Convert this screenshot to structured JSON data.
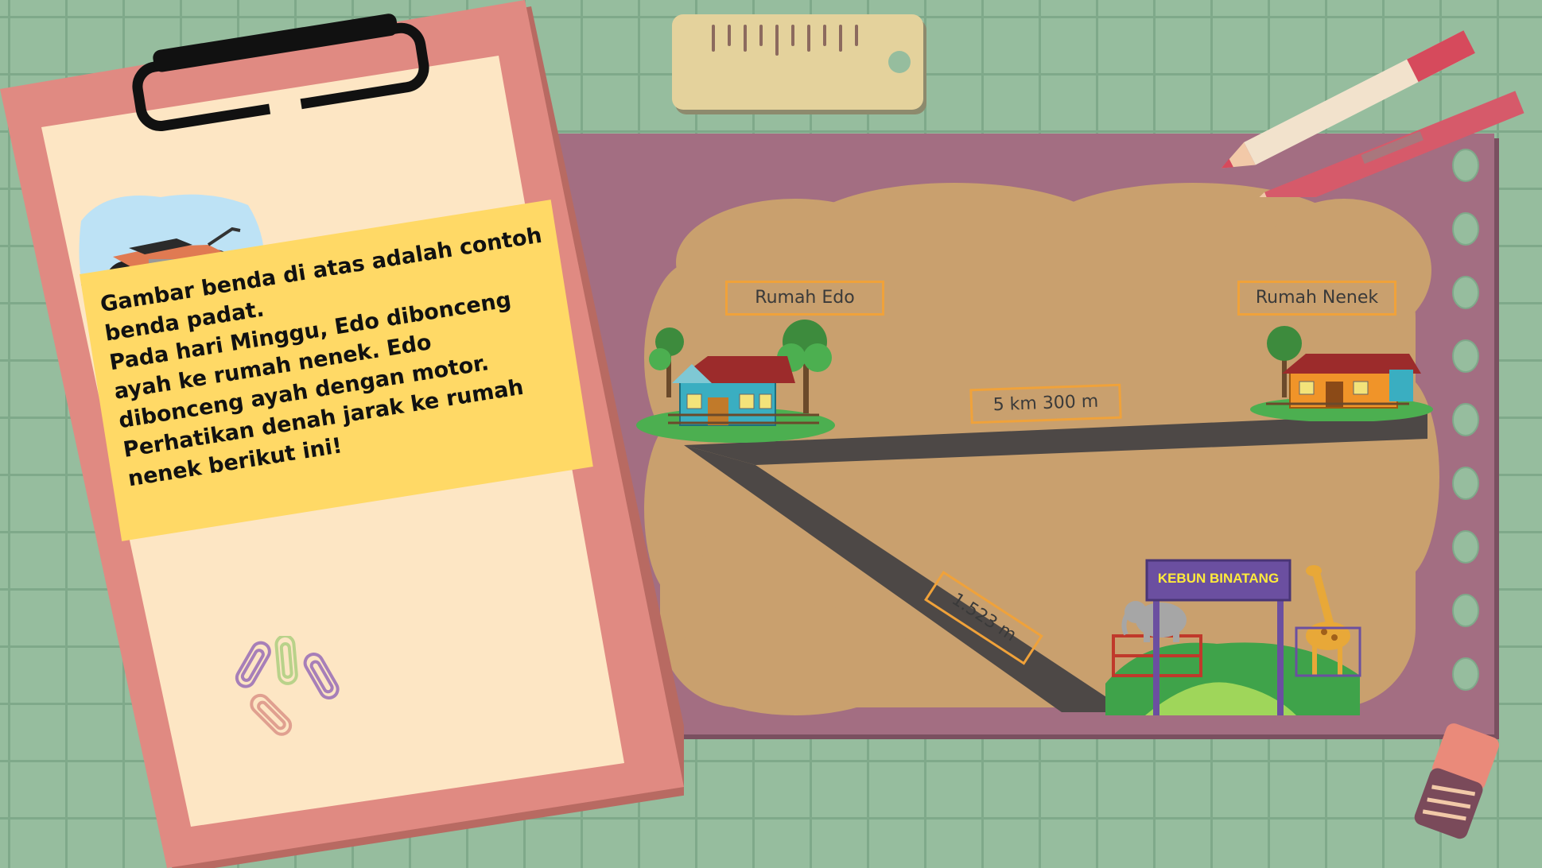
{
  "card": {
    "text_line1": "Gambar benda di atas adalah contoh benda padat.",
    "text_line2": "Pada hari Minggu, Edo dibonceng ayah ke rumah nenek. Edo dibonceng ayah dengan motor. Perhatikan denah jarak ke rumah nenek berikut ini!"
  },
  "map": {
    "label_edo": "Rumah Edo",
    "label_nenek": "Rumah Nenek",
    "distance_main": "5 km 300 m",
    "distance_branch": "1.523 m",
    "zoo_sign": "KEBUN BINATANG"
  },
  "colors": {
    "background": "#96bd9e",
    "clipboard": "#e08a82",
    "paper": "#fde6c4",
    "board": "#a36e82",
    "map_land": "#c9a06e",
    "road": "#4d4846",
    "label_border": "#f0a23a",
    "highlight": "#ffd966"
  },
  "icons": [
    "motorcycle-icon",
    "house-icon",
    "tree-icon",
    "elephant-icon",
    "giraffe-icon",
    "paperclip-icon",
    "ruler-icon",
    "pencil-icon",
    "eraser-icon"
  ]
}
